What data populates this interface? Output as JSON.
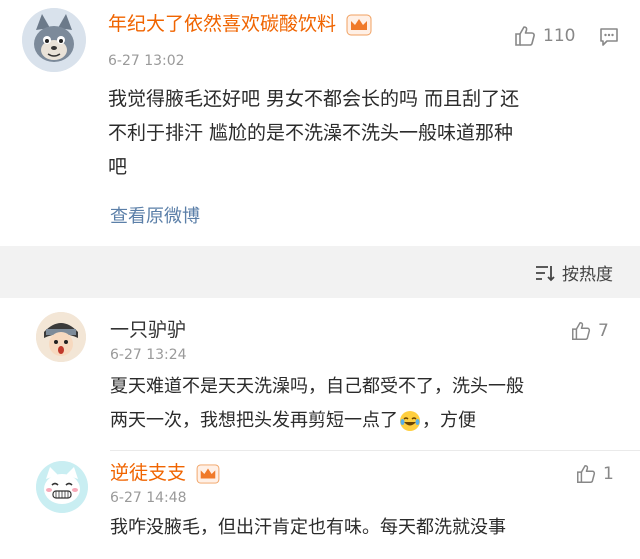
{
  "main_post": {
    "username": "年纪大了依然喜欢碳酸饮料",
    "time": "6-27 13:02",
    "likes": "110",
    "text_line1": "我觉得腋毛还好吧 男女不都会长的吗 而且刮了还",
    "text_line2": "不利于排汗  尴尬的是不洗澡不洗头一般味道那种",
    "text_line3": "吧",
    "view_link": "查看原微博"
  },
  "sort": {
    "label": "按热度"
  },
  "comments": [
    {
      "username": "一只驴驴",
      "time": "6-27 13:24",
      "likes": "7",
      "text_line1": "夏天难道不是天天洗澡吗，自己都受不了，洗头一般",
      "text_line2_a": "两天一次，我想把头发再剪短一点了",
      "text_line2_b": "，方便"
    },
    {
      "username": "逆徒支支",
      "time": "6-27 14:48",
      "likes": "1",
      "text_line1": "我咋没腋毛，但出汗肯定也有味。每天都洗就没事"
    }
  ],
  "colors": {
    "vip_name": "#f06400",
    "link": "#5b7fa8",
    "meta": "#9a9a9a"
  }
}
